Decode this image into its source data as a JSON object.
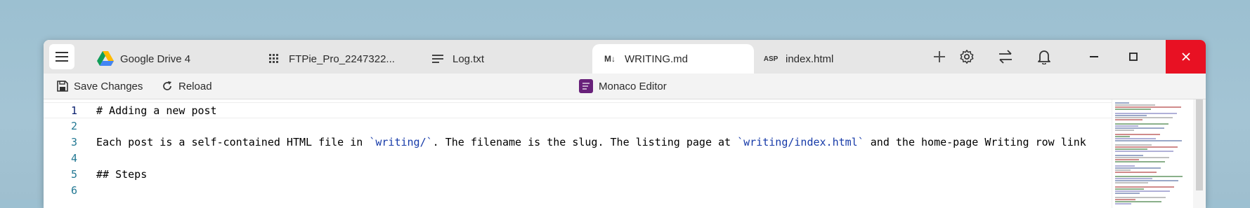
{
  "tabs": [
    {
      "label": "Google Drive 4",
      "icon": "google-drive-icon"
    },
    {
      "label": "FTPie_Pro_2247322...",
      "icon": "grid-icon"
    },
    {
      "label": "Log.txt",
      "icon": "text-lines-icon"
    },
    {
      "label": "WRITING.md",
      "icon": "markdown-icon",
      "icon_text": "M↓",
      "active": true
    },
    {
      "label": "index.html",
      "icon": "asp-icon",
      "icon_text": "ASP"
    }
  ],
  "toolbar": {
    "save_label": "Save Changes",
    "reload_label": "Reload",
    "editor_name": "Monaco Editor"
  },
  "editor": {
    "lines": [
      {
        "num": "1",
        "text": "# Adding a new post"
      },
      {
        "num": "2",
        "text": ""
      },
      {
        "num": "3",
        "text": "Each post is a self-contained HTML file in `writing/`. The filename is the slug. The listing page at `writing/index.html` and the home-page Writing row link"
      },
      {
        "num": "4",
        "text": ""
      },
      {
        "num": "5",
        "text": "## Steps"
      },
      {
        "num": "6",
        "text": ""
      }
    ]
  },
  "colors": {
    "close_button": "#e81123",
    "heading": "#0000ff",
    "line_number": "#237893",
    "code_span": "#163aa8"
  }
}
